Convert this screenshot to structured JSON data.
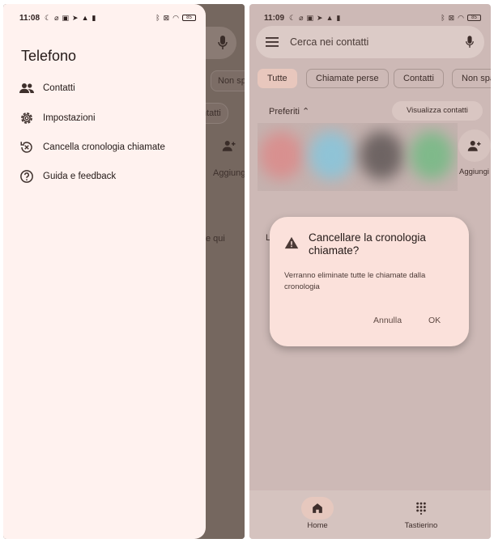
{
  "left_screen": {
    "status_bar": {
      "time": "11:08",
      "battery": "85"
    },
    "drawer": {
      "title": "Telefono",
      "items": [
        {
          "label": "Contatti",
          "icon": "contacts-icon"
        },
        {
          "label": "Impostazioni",
          "icon": "gear-icon"
        },
        {
          "label": "Cancella cronologia chiamate",
          "icon": "clear-history-icon"
        },
        {
          "label": "Guida e feedback",
          "icon": "help-icon"
        }
      ]
    },
    "background": {
      "chip_partial": "Non spa",
      "button_partial": "ntatti",
      "add_partial": "Aggiungi",
      "text_partial": "e qui"
    }
  },
  "right_screen": {
    "status_bar": {
      "time": "11:09",
      "battery": "85"
    },
    "search": {
      "placeholder": "Cerca nei contatti"
    },
    "chips": [
      {
        "label": "Tutte",
        "active": true
      },
      {
        "label": "Chiamate perse",
        "active": false
      },
      {
        "label": "Contatti",
        "active": false
      },
      {
        "label": "Non spa",
        "active": false
      }
    ],
    "favorites_label": "Preferiti",
    "view_contacts_label": "Visualizza contatti",
    "add_label": "Aggiungi",
    "background_letter": "L",
    "dialog": {
      "title": "Cancellare la cronologia chiamate?",
      "body": "Verranno eliminate tutte le chiamate dalla cronologia",
      "cancel_label": "Annulla",
      "ok_label": "OK"
    },
    "bottom_nav": [
      {
        "label": "Home",
        "icon": "home-icon",
        "active": true
      },
      {
        "label": "Tastierino",
        "icon": "dialpad-icon",
        "active": false
      }
    ]
  },
  "colors": {
    "drawer_bg": "#fff2ef",
    "dialog_bg": "#fbe1db",
    "active_chip": "#e8c7bd"
  }
}
